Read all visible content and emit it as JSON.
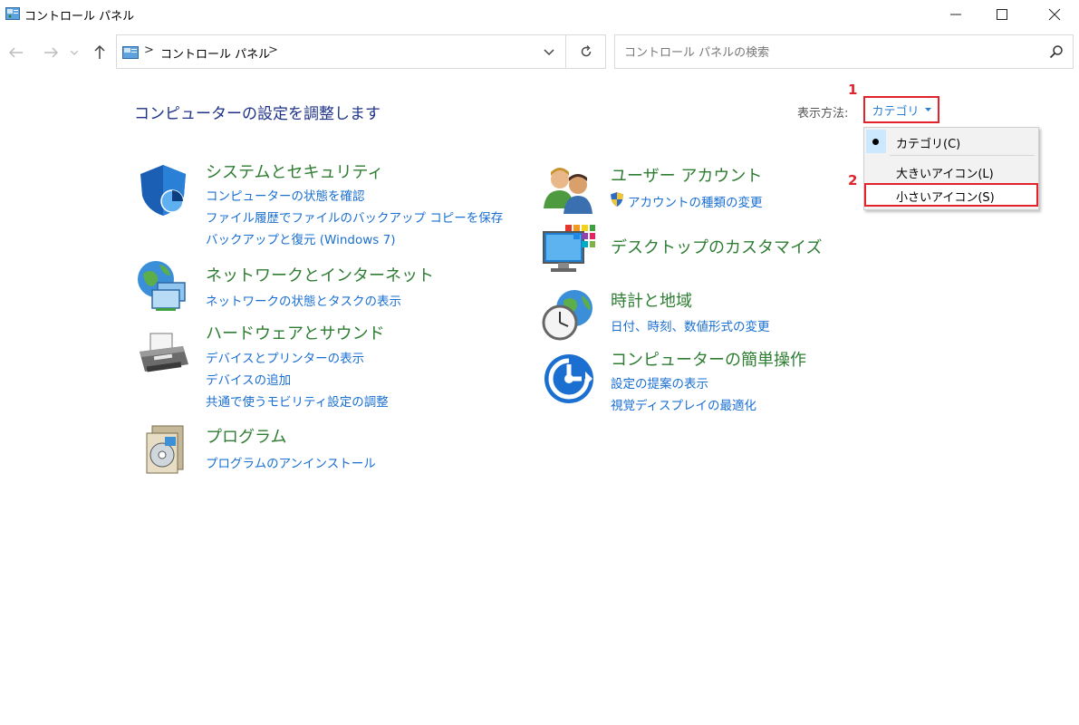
{
  "window": {
    "title": "コントロール パネル"
  },
  "address": {
    "path": "コントロール パネル",
    "separator": ">"
  },
  "search": {
    "placeholder": "コントロール パネルの検索"
  },
  "header": {
    "title": "コンピューターの設定を調整します",
    "view_label": "表示方法:",
    "view_value": "カテゴリ"
  },
  "markers": [
    "1",
    "2"
  ],
  "view_menu": {
    "items": [
      {
        "label": "カテゴリ(C)",
        "checked": true
      },
      {
        "label": "大きいアイコン(L)",
        "checked": false
      },
      {
        "label": "小さいアイコン(S)",
        "checked": false
      }
    ]
  },
  "categories_left": [
    {
      "icon": "shield-icon",
      "title": "システムとセキュリティ",
      "links": [
        "コンピューターの状態を確認",
        "ファイル履歴でファイルのバックアップ コピーを保存",
        "バックアップと復元 (Windows 7)"
      ]
    },
    {
      "icon": "network-globe-icon",
      "title": "ネットワークとインターネット",
      "links": [
        "ネットワークの状態とタスクの表示"
      ]
    },
    {
      "icon": "printer-icon",
      "title": "ハードウェアとサウンド",
      "links": [
        "デバイスとプリンターの表示",
        "デバイスの追加",
        "共通で使うモビリティ設定の調整"
      ]
    },
    {
      "icon": "programs-icon",
      "title": "プログラム",
      "links": [
        "プログラムのアンインストール"
      ]
    }
  ],
  "categories_right": [
    {
      "icon": "users-icon",
      "title": "ユーザー アカウント",
      "links": [
        "アカウントの種類の変更"
      ]
    },
    {
      "icon": "monitor-icon",
      "title": "デスクトップのカスタマイズ",
      "links": []
    },
    {
      "icon": "clock-globe-icon",
      "title": "時計と地域",
      "links": [
        "日付、時刻、数値形式の変更"
      ]
    },
    {
      "icon": "ease-of-access-icon",
      "title": "コンピューターの簡単操作",
      "links": [
        "設定の提案の表示",
        "視覚ディスプレイの最適化"
      ]
    }
  ],
  "colors": {
    "accent_red": "#e3222b",
    "link_blue": "#1a6fd1",
    "category_green": "#2e7d32",
    "heading_blue": "#1e3287"
  }
}
